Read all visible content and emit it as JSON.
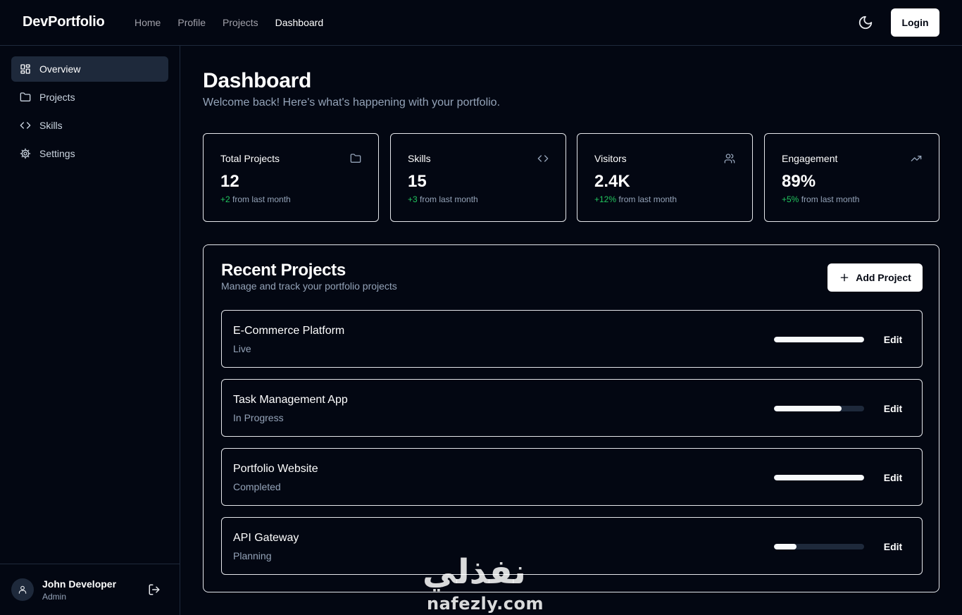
{
  "nav": {
    "brand": "DevPortfolio",
    "links": [
      {
        "label": "Home",
        "active": false
      },
      {
        "label": "Profile",
        "active": false
      },
      {
        "label": "Projects",
        "active": false
      },
      {
        "label": "Dashboard",
        "active": true
      }
    ],
    "theme_icon": "moon-icon",
    "login_label": "Login"
  },
  "sidebar": {
    "items": [
      {
        "label": "Overview",
        "icon": "grid-icon",
        "active": true
      },
      {
        "label": "Projects",
        "icon": "folder-icon",
        "active": false
      },
      {
        "label": "Skills",
        "icon": "code-icon",
        "active": false
      },
      {
        "label": "Settings",
        "icon": "gear-icon",
        "active": false
      }
    ],
    "user": {
      "name": "John Developer",
      "role": "Admin",
      "avatar_icon": "user-icon",
      "logout_icon": "logout-icon"
    }
  },
  "main": {
    "title": "Dashboard",
    "subtitle": "Welcome back! Here's what's happening with your portfolio.",
    "stats": [
      {
        "label": "Total Projects",
        "value": "12",
        "change": "+2",
        "change_suffix": "from last month",
        "icon": "folder-icon"
      },
      {
        "label": "Skills",
        "value": "15",
        "change": "+3",
        "change_suffix": "from last month",
        "icon": "code-icon"
      },
      {
        "label": "Visitors",
        "value": "2.4K",
        "change": "+12%",
        "change_suffix": "from last month",
        "icon": "users-icon"
      },
      {
        "label": "Engagement",
        "value": "89%",
        "change": "+5%",
        "change_suffix": "from last month",
        "icon": "trending-up-icon"
      }
    ],
    "recent_projects": {
      "title": "Recent Projects",
      "subtitle": "Manage and track your portfolio projects",
      "add_label": "Add Project",
      "edit_label": "Edit",
      "items": [
        {
          "name": "E-Commerce Platform",
          "status": "Live",
          "progress": 100
        },
        {
          "name": "Task Management App",
          "status": "In Progress",
          "progress": 75
        },
        {
          "name": "Portfolio Website",
          "status": "Completed",
          "progress": 100
        },
        {
          "name": "API Gateway",
          "status": "Planning",
          "progress": 25
        }
      ]
    }
  },
  "watermark": {
    "arabic": "نفذلي",
    "latin": "nafezly.com"
  },
  "colors": {
    "background": "#030712",
    "border": "#1e293b",
    "accent": "#ffffff",
    "positive": "#22c55e",
    "muted": "#94a3b8"
  }
}
